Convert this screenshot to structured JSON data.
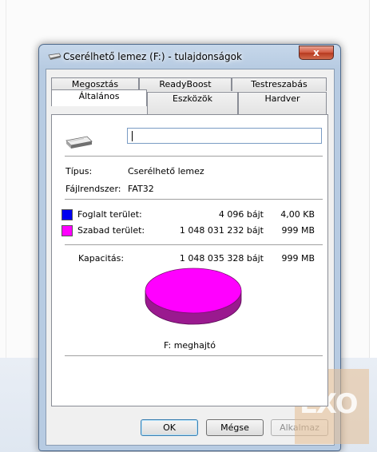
{
  "window": {
    "title": "Cserélhető lemez (F:) - tulajdonságok",
    "close_glyph": "x"
  },
  "tabs_row1": [
    {
      "label": "Megosztás"
    },
    {
      "label": "ReadyBoost"
    },
    {
      "label": "Testreszabás"
    }
  ],
  "tabs_row2": [
    {
      "label": "Általános",
      "active": true
    },
    {
      "label": "Eszközök"
    },
    {
      "label": "Hardver"
    }
  ],
  "general": {
    "name_value": "",
    "type_label": "Típus:",
    "type_value": "Cserélhető lemez",
    "fs_label": "Fájlrendszer:",
    "fs_value": "FAT32",
    "used_label": "Foglalt terület:",
    "used_bytes": "4 096 bájt",
    "used_size": "4,00 KB",
    "free_label": "Szabad terület:",
    "free_bytes": "1 048 031 232 bájt",
    "free_size": "999 MB",
    "capacity_label": "Kapacitás:",
    "capacity_bytes": "1 048 035 328 bájt",
    "capacity_size": "999 MB",
    "drive_label": "F: meghajtó"
  },
  "colors": {
    "used": "#0000f0",
    "free": "#ff00ff",
    "free_side": "#9a1a8f"
  },
  "buttons": {
    "ok": "OK",
    "cancel": "Mégse",
    "apply": "Alkalmaz"
  },
  "watermark": {
    "text": "LXO"
  }
}
